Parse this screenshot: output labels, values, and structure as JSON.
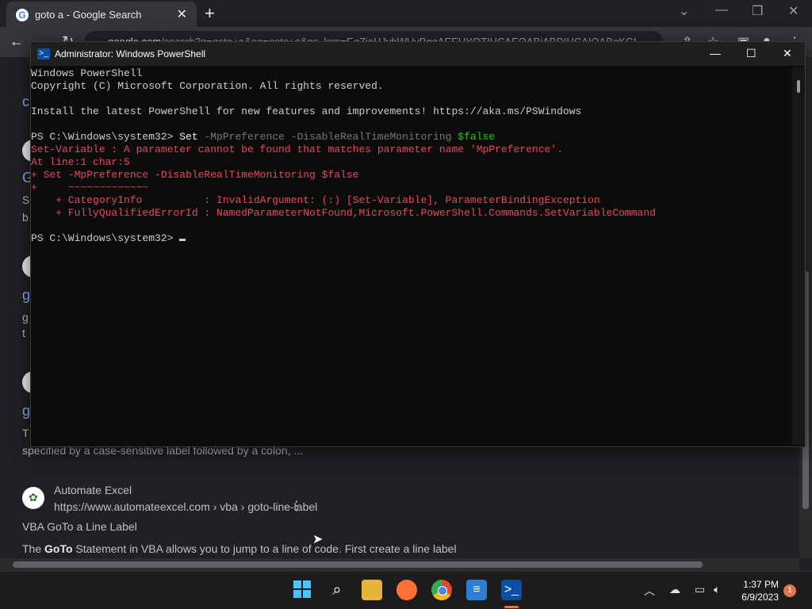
{
  "browser": {
    "tab_title": "goto a - Google Search",
    "new_tab": "+",
    "address": "google.com/search?q=goto+a&oq=goto+a&gs_lcrp=EgZjaHJvbWUyBggAEEUYOTIHCAEQABiABDIHCAIQABgKGL...",
    "address_domain": "google.com",
    "address_rest": "/search?q=goto+a&oq=goto+a&gs_lcrp=EgZjaHJvbWUyBggAEEUYOTIHCAEQABiABDIHCAIQABgKGL..."
  },
  "results": {
    "item_automate": {
      "site": "Automate Excel",
      "url": "https://www.automateexcel.com › vba › goto-line-label",
      "title": "VBA GoTo a Line Label",
      "snippet_bold": "GoTo",
      "snippet_pre": "The ",
      "snippet_post": " Statement in VBA allows you to jump to a line of code. First create a line label"
    },
    "partial_snippet": "specified by a case-sensitive label followed by a colon, ..."
  },
  "powershell": {
    "title": "Administrator: Windows PowerShell",
    "lines": {
      "l1": "Windows PowerShell",
      "l2": "Copyright (C) Microsoft Corporation. All rights reserved.",
      "l3": "Install the latest PowerShell for new features and improvements! https://aka.ms/PSWindows",
      "prompt": "PS C:\\Windows\\system32> ",
      "cmd_set": "Set",
      "cmd_args": " -MpPreference -DisableRealTimeMonitoring ",
      "cmd_false": "$false",
      "err1": "Set-Variable : A parameter cannot be found that matches parameter name 'MpPreference'.",
      "err2": "At line:1 char:5",
      "err3": "+ Set -MpPreference -DisableRealTimeMonitoring $false",
      "err4": "+     ~~~~~~~~~~~~~",
      "err5": "    + CategoryInfo          : InvalidArgument: (:) [Set-Variable], ParameterBindingException",
      "err6": "    + FullyQualifiedErrorId : NamedParameterNotFound,Microsoft.PowerShell.Commands.SetVariableCommand",
      "prompt2": "PS C:\\Windows\\system32> "
    }
  },
  "taskbar": {
    "time": "1:37 PM",
    "date": "6/9/2023",
    "notifications": "1"
  },
  "colors": {
    "ps_error": "#e74856",
    "ps_green": "#16c60c",
    "link": "#8ab4f8"
  }
}
